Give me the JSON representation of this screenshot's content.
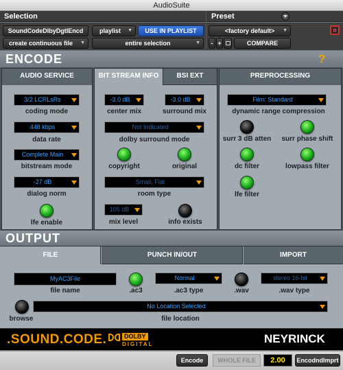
{
  "window": {
    "title": "AudioSuite"
  },
  "selection": {
    "header": "Selection",
    "plugin_name": "SoundCodeDlbyDgtlEncd",
    "playlist_label": "playlist",
    "use_in_playlist": "USE IN PLAYLIST",
    "mode": "create continuous file",
    "scope": "entire selection"
  },
  "preset": {
    "header": "Preset",
    "current": "<factory default>",
    "minus": "-",
    "plus": "+",
    "compare": "COMPARE"
  },
  "encode": {
    "title": "ENCODE",
    "help": "?",
    "audio_service": {
      "title": "AUDIO SERVICE",
      "coding_mode_value": "3/2 LCRLsRs",
      "coding_mode_label": "coding mode",
      "data_rate_value": "448 kbps",
      "data_rate_label": "data rate",
      "bitstream_mode_value": "Complete Main",
      "bitstream_mode_label": "bitstream  mode",
      "dialog_norm_value": "-27 dB",
      "dialog_norm_label": "dialog norm",
      "lfe_enable_label": "lfe enable"
    },
    "bitstream_info": {
      "tab_label": "BIT STREAM INFO",
      "ext_tab_label": "BSI EXT",
      "center_mix_value": "-3.0 dB",
      "center_mix_label": "center mix",
      "surround_mix_value": "-3.0 dB",
      "surround_mix_label": "surround mix",
      "dolby_surround_value": "Not Indicated",
      "dolby_surround_label": "dolby surround mode",
      "copyright_label": "copyright",
      "original_label": "original",
      "room_type_value": "Small, Flat",
      "room_type_label": "room type",
      "mix_level_value": "105 dB",
      "mix_level_label": "mix level",
      "info_exists_label": "info exists"
    },
    "preprocessing": {
      "title": "PREPROCESSING",
      "drc_value": "Film: Standard",
      "drc_label": "dynamic range compression",
      "surr3db_label": "surr 3 dB atten",
      "surr_phase_label": "surr phase shift",
      "dc_filter_label": "dc filter",
      "lowpass_label": "lowpass filter",
      "lfe_filter_label": "lfe filter"
    }
  },
  "output": {
    "title": "OUTPUT",
    "tabs": [
      "FILE",
      "PUNCH IN/OUT",
      "IMPORT"
    ],
    "file_name_value": "MyAC3File",
    "file_name_label": "file name",
    "ac3_label": ".ac3",
    "ac3_type_value": "Normal",
    "ac3_type_label": ".ac3 type",
    "wav_label": ".wav",
    "wav_type_value": "stereo 16-bit",
    "wav_type_label": ".wav type",
    "browse_label": "browse",
    "file_location_value": "No Location Selected",
    "file_location_label": "file location"
  },
  "branding": {
    "brand_left": ".SOUND.CODE.",
    "dolby_top": "DOLBY",
    "dolby_bottom": "DIGITAL",
    "brand_right": "NEYRINCK"
  },
  "footer": {
    "encode_button": "Encode",
    "whole_file": "WHOLE FILE",
    "value": "2.00",
    "plugin_short": "EncodndImprt"
  },
  "colors": {
    "green_led": "#18a81b",
    "accent_orange": "#f39a00",
    "value_blue": "#3aa0ff",
    "use_in_playlist_blue": "#2d66cc"
  }
}
